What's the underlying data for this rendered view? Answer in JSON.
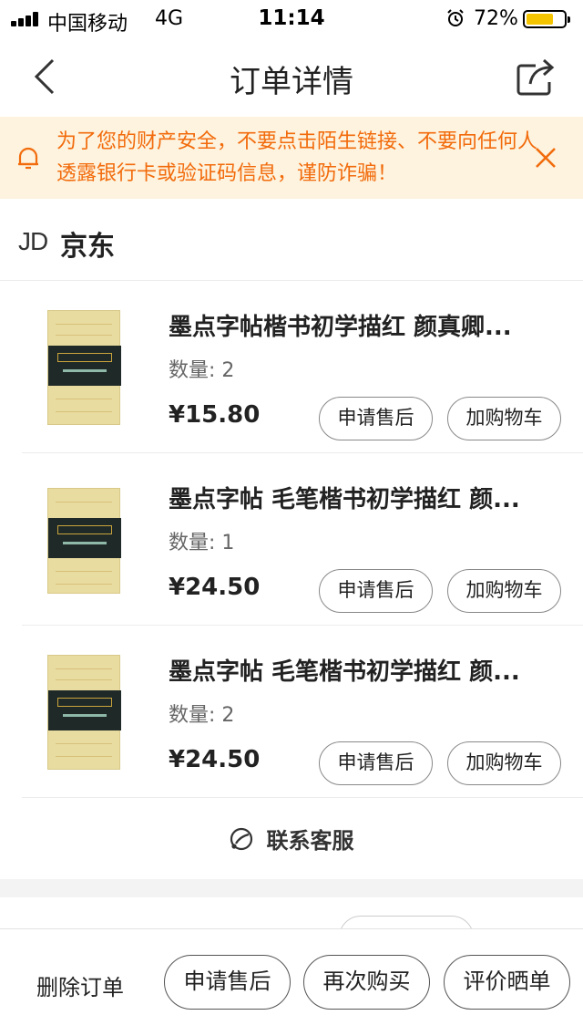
{
  "status_bar": {
    "carrier": "中国移动",
    "network": "4G",
    "time": "11:14",
    "battery_percent": "72%",
    "battery_level": 0.72
  },
  "nav": {
    "title": "订单详情",
    "back_icon": "chevron-left-icon",
    "share_icon": "share-icon"
  },
  "notice": {
    "text": "为了您的财产安全，不要点击陌生链接、不要向任何人透露银行卡或验证码信息，谨防诈骗！",
    "color": "#f26b0c",
    "background": "#fdf3de"
  },
  "shop": {
    "logo": "JD",
    "name": "京东"
  },
  "items": [
    {
      "title": "墨点字帖楷书初学描红 颜真卿...",
      "qty": "数量: 2",
      "price": "¥15.80",
      "after_sale": "申请售后",
      "add_cart": "加购物车"
    },
    {
      "title": "墨点字帖 毛笔楷书初学描红 颜...",
      "qty": "数量: 1",
      "price": "¥24.50",
      "after_sale": "申请售后",
      "add_cart": "加购物车"
    },
    {
      "title": "墨点字帖 毛笔楷书初学描红 颜...",
      "qty": "数量: 2",
      "price": "¥24.50",
      "after_sale": "申请售后",
      "add_cart": "加购物车"
    }
  ],
  "contact": {
    "label": "联系客服",
    "icon": "customer-service-icon"
  },
  "bottom_bar": {
    "delete": "删除订单",
    "after_sale": "申请售后",
    "buy_again": "再次购买",
    "review": "评价晒单"
  }
}
